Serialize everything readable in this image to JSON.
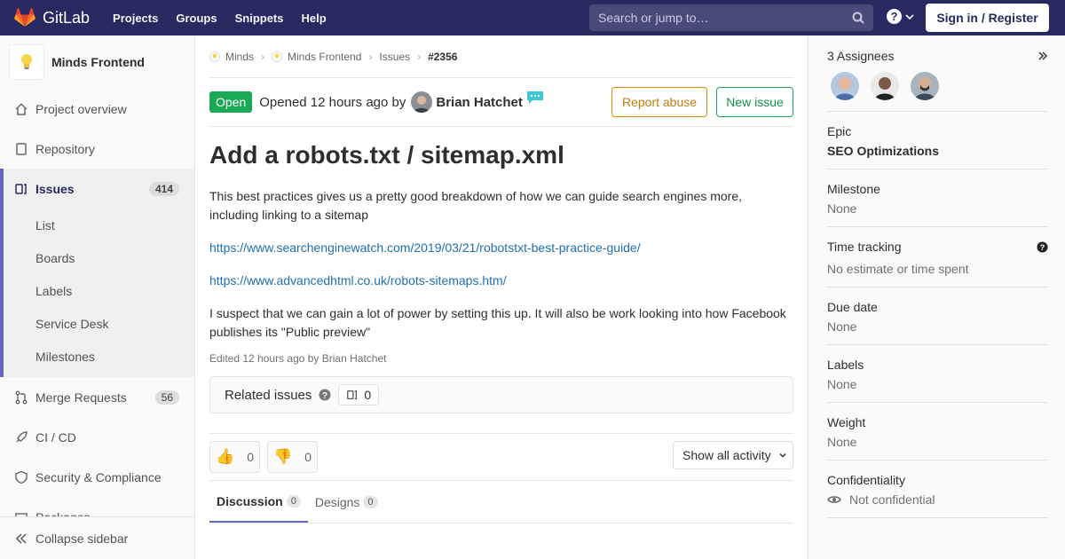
{
  "navbar": {
    "brand": "GitLab",
    "links": [
      "Projects",
      "Groups",
      "Snippets",
      "Help"
    ],
    "search_placeholder": "Search or jump to…",
    "signin": "Sign in / Register"
  },
  "sidebar": {
    "project_name": "Minds Frontend",
    "items": {
      "overview": "Project overview",
      "repository": "Repository",
      "issues": "Issues",
      "issues_count": "414",
      "merge_requests": "Merge Requests",
      "mr_count": "56",
      "cicd": "CI / CD",
      "security": "Security & Compliance",
      "packages": "Packages"
    },
    "sub_items": [
      "List",
      "Boards",
      "Labels",
      "Service Desk",
      "Milestones"
    ],
    "collapse": "Collapse sidebar"
  },
  "breadcrumb": [
    "Minds",
    "Minds Frontend",
    "Issues",
    "#2356"
  ],
  "issue": {
    "state": "Open",
    "opened_text": "Opened 12 hours ago by",
    "author": "Brian Hatchet",
    "report_abuse": "Report abuse",
    "new_issue": "New issue",
    "title": "Add a robots.txt / sitemap.xml",
    "desc_p1": "This best practices gives us a pretty good breakdown of how we can guide search engines more, including linking to a sitemap",
    "link1": "https://www.searchenginewatch.com/2019/03/21/robotstxt-best-practice-guide/",
    "link2": "https://www.advancedhtml.co.uk/robots-sitemaps.htm/",
    "desc_p2": "I suspect that we can gain a lot of power by setting this up. It will also be work looking into how Facebook publishes its \"Public preview\"",
    "edited": "Edited 12 hours ago by Brian Hatchet",
    "related_label": "Related issues",
    "related_count": "0",
    "thumbs_up": "0",
    "thumbs_down": "0",
    "activity": "Show all activity",
    "tab_discussion": "Discussion",
    "tab_discussion_count": "0",
    "tab_designs": "Designs",
    "tab_designs_count": "0"
  },
  "right_sidebar": {
    "assignees_title": "3 Assignees",
    "epic_title": "Epic",
    "epic_value": "SEO Optimizations",
    "milestone_title": "Milestone",
    "milestone_value": "None",
    "time_title": "Time tracking",
    "time_value": "No estimate or time spent",
    "due_title": "Due date",
    "due_value": "None",
    "labels_title": "Labels",
    "labels_value": "None",
    "weight_title": "Weight",
    "weight_value": "None",
    "conf_title": "Confidentiality",
    "conf_value": "Not confidential"
  },
  "colors": {
    "navbar": "#292961",
    "open_state": "#1aaa55",
    "accent": "#6666c4"
  }
}
